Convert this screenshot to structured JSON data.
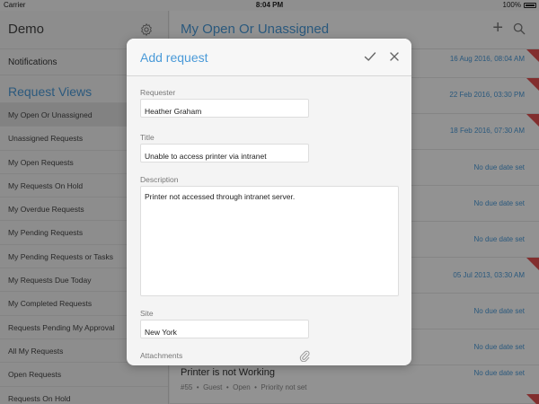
{
  "status_bar": {
    "carrier": "Carrier",
    "time": "8:04 PM",
    "battery": "100%"
  },
  "sidebar": {
    "title": "Demo",
    "notifications": "Notifications",
    "views_title": "Request Views",
    "items": [
      {
        "label": "My Open Or Unassigned",
        "active": true
      },
      {
        "label": "Unassigned Requests"
      },
      {
        "label": "My Open Requests"
      },
      {
        "label": "My Requests On Hold"
      },
      {
        "label": "My Overdue Requests"
      },
      {
        "label": "My Pending Requests"
      },
      {
        "label": "My Pending Requests or Tasks"
      },
      {
        "label": "My Requests Due Today"
      },
      {
        "label": "My Completed Requests"
      },
      {
        "label": "Requests Pending My Approval"
      },
      {
        "label": "All My Requests"
      },
      {
        "label": "Open Requests"
      },
      {
        "label": "Requests On Hold"
      }
    ]
  },
  "main": {
    "title": "My Open Or Unassigned",
    "rows": [
      {
        "due": "16 Aug 2016, 08:04 AM",
        "flag": true
      },
      {
        "due": "22 Feb 2016, 03:30 PM",
        "flag": true
      },
      {
        "due": "18 Feb 2016, 07:30 AM",
        "flag": true
      },
      {
        "due": "No due date set",
        "flag": false
      },
      {
        "due": "No due date set",
        "flag": false
      },
      {
        "due": "No due date set",
        "flag": false
      },
      {
        "due": "05 Jul 2013, 03:30 AM",
        "flag": true
      },
      {
        "due": "No due date set",
        "flag": false
      },
      {
        "due": "No due date set",
        "flag": false
      },
      {
        "due": "No due date set",
        "flag": false
      }
    ],
    "visible_request": {
      "title": "Printer is not Working",
      "id": "#55",
      "requester": "Guest",
      "status": "Open",
      "priority": "Priority not set"
    }
  },
  "modal": {
    "title": "Add request",
    "requester_label": "Requester",
    "requester_value": "Heather Graham",
    "title_label": "Title",
    "title_value": "Unable to access printer via intranet",
    "description_label": "Description",
    "description_value": "Printer not accessed through intranet server.",
    "site_label": "Site",
    "site_value": "New York",
    "attachments_label": "Attachments"
  },
  "icons": {
    "settings": "gear-icon",
    "add": "plus-icon",
    "search": "search-icon",
    "confirm": "check-icon",
    "close": "close-icon",
    "attachment": "paperclip-icon"
  },
  "colors": {
    "accent": "#4a9ad8",
    "flag": "#e05050"
  }
}
